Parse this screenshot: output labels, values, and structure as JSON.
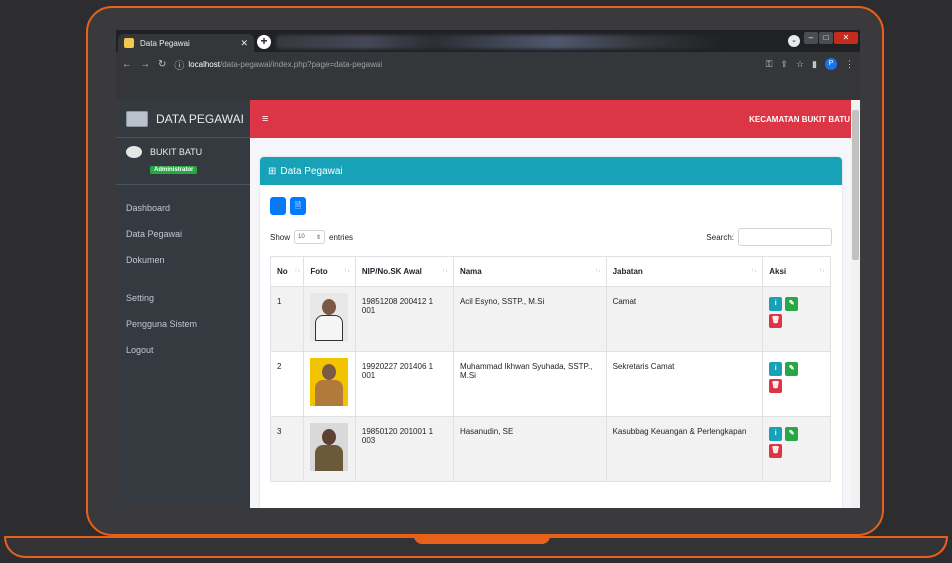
{
  "browser": {
    "tab_title": "Data Pegawai",
    "url_host": "localhost",
    "url_path": "/data-pegawai/index.php?page=data-pegawai",
    "profile_initial": "P"
  },
  "sidebar": {
    "brand": "DATA PEGAWAI",
    "user_name": "BUKIT BATU",
    "user_role": "Administrator",
    "items": [
      {
        "label": "Dashboard"
      },
      {
        "label": "Data Pegawai"
      },
      {
        "label": "Dokumen"
      },
      {
        "label": "Setting"
      },
      {
        "label": "Pengguna Sistem"
      },
      {
        "label": "Logout"
      }
    ]
  },
  "topnav": {
    "title": "KECAMATAN BUKIT BATU"
  },
  "card": {
    "title": "Data Pegawai",
    "show_label": "Show",
    "entries_value": "10",
    "entries_label": "entries",
    "search_label": "Search:"
  },
  "table": {
    "headers": [
      "No",
      "Foto",
      "NIP/No.SK Awal",
      "Nama",
      "Jabatan",
      "Aksi"
    ],
    "rows": [
      {
        "no": "1",
        "nip": "19851208 200412 1 001",
        "nama": "Acil Esyno, SSTP., M.Si",
        "jabatan": "Camat"
      },
      {
        "no": "2",
        "nip": "19920227 201406 1 001",
        "nama": "Muhammad Ikhwan Syuhada, SSTP., M.Si",
        "jabatan": "Sekretaris Camat"
      },
      {
        "no": "3",
        "nip": "19850120 201001 1 003",
        "nama": "Hasanudin, SE",
        "jabatan": "Kasubbag Keuangan & Perlengkapan"
      }
    ]
  },
  "colors": {
    "accent_frame": "#e8611a",
    "navbar": "#dc3545",
    "card_header": "#17a2b8",
    "sidebar": "#343a40"
  }
}
